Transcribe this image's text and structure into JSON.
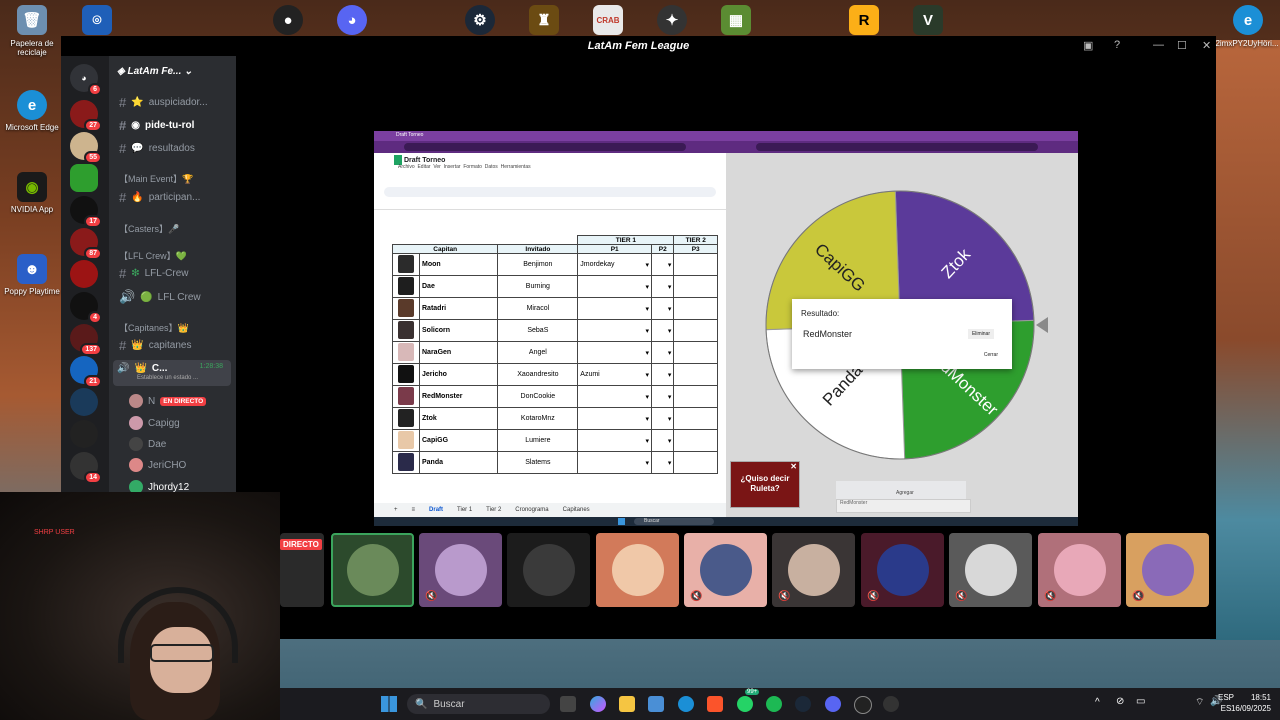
{
  "desktop": {
    "icons_left": [
      {
        "label": "Papelera de reciclaje",
        "icon": "recycle-bin-icon"
      },
      {
        "label": "Microsoft Edge",
        "icon": "edge-icon"
      },
      {
        "label": "NVIDIA App",
        "icon": "nvidia-icon"
      },
      {
        "label": "Poppy Playtime",
        "icon": "poppy-playtime-icon"
      }
    ],
    "icon_right_label": "2imxPY2UyHöri..."
  },
  "discord": {
    "window_title": "LatAm Fem League",
    "server_name": "LatAm Fe...",
    "guild_badges": [
      "6",
      "27",
      "55",
      "17",
      "87",
      "4",
      "137",
      "21",
      "14"
    ],
    "channels": [
      {
        "type": "text",
        "emoji": "⭐",
        "label": "auspiciador..."
      },
      {
        "type": "text",
        "emoji": "◉",
        "label": "pide-tu-rol"
      },
      {
        "type": "text",
        "emoji": "💬",
        "label": "resultados"
      },
      {
        "type": "category",
        "label": "【Main Event】🏆"
      },
      {
        "type": "text",
        "emoji": "🔥",
        "label": "participan..."
      },
      {
        "type": "category",
        "label": "【Casters】🎤"
      },
      {
        "type": "category",
        "label": "【LFL Crew】💚"
      },
      {
        "type": "text",
        "emoji": "❇",
        "label": "LFL-Crew"
      },
      {
        "type": "voice",
        "emoji": "🟢",
        "label": "LFL Crew"
      },
      {
        "type": "category",
        "label": "【Capitanes】👑"
      },
      {
        "type": "text",
        "emoji": "👑",
        "label": "capitanes"
      }
    ],
    "active_voice": {
      "label": "C...",
      "timer": "1:28:38",
      "status": "Establece un estado ..."
    },
    "live_badge": "EN DIRECTO",
    "live_badge_tile": "DIRECTO",
    "voice_users": [
      "N",
      "Capigg",
      "Dae",
      "JeriCHO",
      "Jhordy12"
    ]
  },
  "spreadsheet": {
    "doc_title": "Draft Torneo",
    "menu": [
      "Archivo",
      "Editar",
      "Ver",
      "Insertar",
      "Formato",
      "Datos",
      "Herramientas"
    ],
    "headers": {
      "captain": "Capitan",
      "invited": "Invitado",
      "tier1": "TIER 1",
      "tier2": "TIER 2",
      "p1": "P1",
      "p2": "P2",
      "p3": "P3"
    },
    "rows": [
      {
        "captain": "Moon",
        "invited": "Benjimon",
        "p1": "Jmordekay"
      },
      {
        "captain": "Dae",
        "invited": "Burning",
        "p1": ""
      },
      {
        "captain": "Ratadri",
        "invited": "Miracol",
        "p1": ""
      },
      {
        "captain": "Solicorn",
        "invited": "SebaS",
        "p1": ""
      },
      {
        "captain": "NaraGen",
        "invited": "Angel",
        "p1": ""
      },
      {
        "captain": "Jericho",
        "invited": "Xaoandresito",
        "p1": "Azumi"
      },
      {
        "captain": "RedMonster",
        "invited": "DonCookie",
        "p1": ""
      },
      {
        "captain": "Ztok",
        "invited": "KotaroMnz",
        "p1": ""
      },
      {
        "captain": "CapiGG",
        "invited": "Lumiere",
        "p1": ""
      },
      {
        "captain": "Panda",
        "invited": "Slatems",
        "p1": ""
      }
    ],
    "sheet_tabs": [
      "Draft",
      "Tier 1",
      "Tier 2",
      "Cronograma",
      "Capitanes"
    ],
    "mini_search": "Buscar"
  },
  "wheel": {
    "segments": [
      {
        "label": "Ztok",
        "color": "#5b3a9a"
      },
      {
        "label": "RedMonster",
        "color": "#2e9e2e"
      },
      {
        "label": "Panda",
        "color": "#ffffff"
      },
      {
        "label": "CapiGG",
        "color": "#c9c83b"
      }
    ],
    "dialog_label": "Resultado:",
    "dialog_value": "RedMonster",
    "dialog_btn1": "Eliminar",
    "dialog_btn2": "Cerrar",
    "ad_text": "¿Quiso decir Ruleta?",
    "input_value": "RedMonster",
    "tool_label": "Agregar"
  },
  "webcam": {
    "user_label": "SHRP USER"
  },
  "taskbar": {
    "search_placeholder": "Buscar",
    "lang_top": "ESP",
    "lang_bottom": "ES",
    "time": "18:51",
    "date": "16/09/2025",
    "badge_count": "99+"
  }
}
